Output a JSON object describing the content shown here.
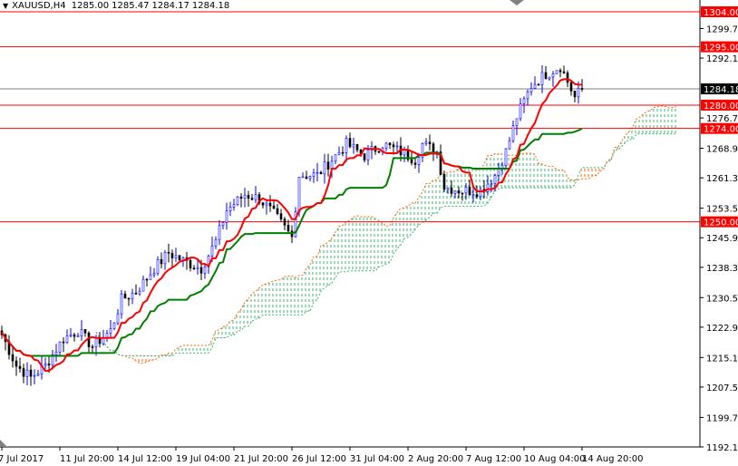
{
  "header": {
    "symbol": "XAUUSD,H4",
    "open": "1285.00",
    "high": "1285.47",
    "low": "1284.17",
    "close": "1284.18"
  },
  "colors": {
    "bull_candle": "#0000ff",
    "bear_candle": "#000000",
    "tenkan": "#ff0000",
    "kijun": "#008000",
    "cloud_bull": "#3cb371",
    "cloud_bear": "#ff6600",
    "level_line": "#ff0000",
    "price_line": "#808080"
  },
  "chart_data": {
    "type": "candlestick",
    "title": "XAUUSD,H4",
    "indicator": "Ichimoku Kinko Hyo",
    "ylim": [
      1192.1,
      1304.0
    ],
    "y_ticks": [
      "1299.70",
      "1292.10",
      "1276.70",
      "1268.90",
      "1261.30",
      "1253.50",
      "1245.90",
      "1238.30",
      "1230.50",
      "1222.90",
      "1215.10",
      "1207.50",
      "1199.70",
      "1192.10"
    ],
    "x_ticks": [
      {
        "label": "7 Jul 2017",
        "bar": 0
      },
      {
        "label": "11 Jul 20:00",
        "bar": 16
      },
      {
        "label": "14 Jul 12:00",
        "bar": 32
      },
      {
        "label": "19 Jul 04:00",
        "bar": 48
      },
      {
        "label": "21 Jul 20:00",
        "bar": 64
      },
      {
        "label": "26 Jul 12:00",
        "bar": 80
      },
      {
        "label": "31 Jul 04:00",
        "bar": 96
      },
      {
        "label": "2 Aug 20:00",
        "bar": 112
      },
      {
        "label": "7 Aug 12:00",
        "bar": 128
      },
      {
        "label": "10 Aug 04:00",
        "bar": 144
      },
      {
        "label": "14 Aug 20:00",
        "bar": 160
      }
    ],
    "levels": [
      {
        "label": "1304.00",
        "value": 1304.0
      },
      {
        "label": "1295.00",
        "value": 1295.0
      },
      {
        "label": "1280.00",
        "value": 1280.0
      },
      {
        "label": "1274.00",
        "value": 1274.0
      },
      {
        "label": "1250.00",
        "value": 1250.0
      }
    ],
    "current_price": {
      "label": "1284.18",
      "value": 1284.18
    },
    "close_keypoints": [
      [
        0,
        1221
      ],
      [
        4,
        1213
      ],
      [
        8,
        1210
      ],
      [
        12,
        1213
      ],
      [
        17,
        1220
      ],
      [
        21,
        1222
      ],
      [
        25,
        1218
      ],
      [
        30,
        1222
      ],
      [
        33,
        1230
      ],
      [
        37,
        1232
      ],
      [
        42,
        1238
      ],
      [
        46,
        1242
      ],
      [
        50,
        1240
      ],
      [
        55,
        1238
      ],
      [
        59,
        1245
      ],
      [
        62,
        1253
      ],
      [
        67,
        1257
      ],
      [
        71,
        1256
      ],
      [
        75,
        1252
      ],
      [
        80,
        1246
      ],
      [
        82,
        1262
      ],
      [
        87,
        1262
      ],
      [
        91,
        1266
      ],
      [
        95,
        1270
      ],
      [
        100,
        1267
      ],
      [
        105,
        1270
      ],
      [
        110,
        1268
      ],
      [
        114,
        1266
      ],
      [
        116,
        1270
      ],
      [
        120,
        1268
      ],
      [
        122,
        1259
      ],
      [
        127,
        1258
      ],
      [
        132,
        1258
      ],
      [
        136,
        1262
      ],
      [
        139,
        1268
      ],
      [
        142,
        1277
      ],
      [
        146,
        1285
      ],
      [
        150,
        1288
      ],
      [
        154,
        1290
      ],
      [
        156,
        1286
      ],
      [
        158,
        1282
      ],
      [
        160,
        1284.18
      ]
    ]
  }
}
